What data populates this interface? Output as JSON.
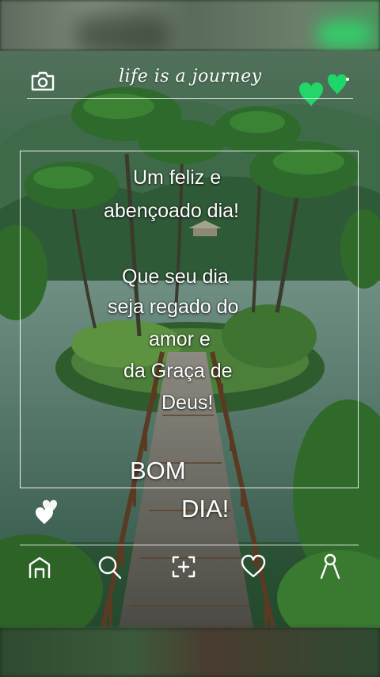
{
  "header": {
    "tagline": "life is a journey",
    "camera_icon": "camera-icon",
    "hearts_icon": "green-double-heart-icon",
    "hearts_color": "#22d66a"
  },
  "message": {
    "line1": "Um feliz e",
    "line2": "abençoado dia!",
    "line3": "Que seu dia",
    "line4": "seja regado do",
    "line5": "amor e",
    "line6": "da Graça de",
    "line7": "Deus!",
    "closing1": "BOM",
    "closing2": "DIA!"
  },
  "side": {
    "white_heart_icon": "white-double-heart-icon"
  },
  "bottom_nav": {
    "items": [
      {
        "icon": "home-icon"
      },
      {
        "icon": "search-icon"
      },
      {
        "icon": "add-frame-icon"
      },
      {
        "icon": "heart-icon"
      },
      {
        "icon": "profile-icon"
      }
    ]
  }
}
